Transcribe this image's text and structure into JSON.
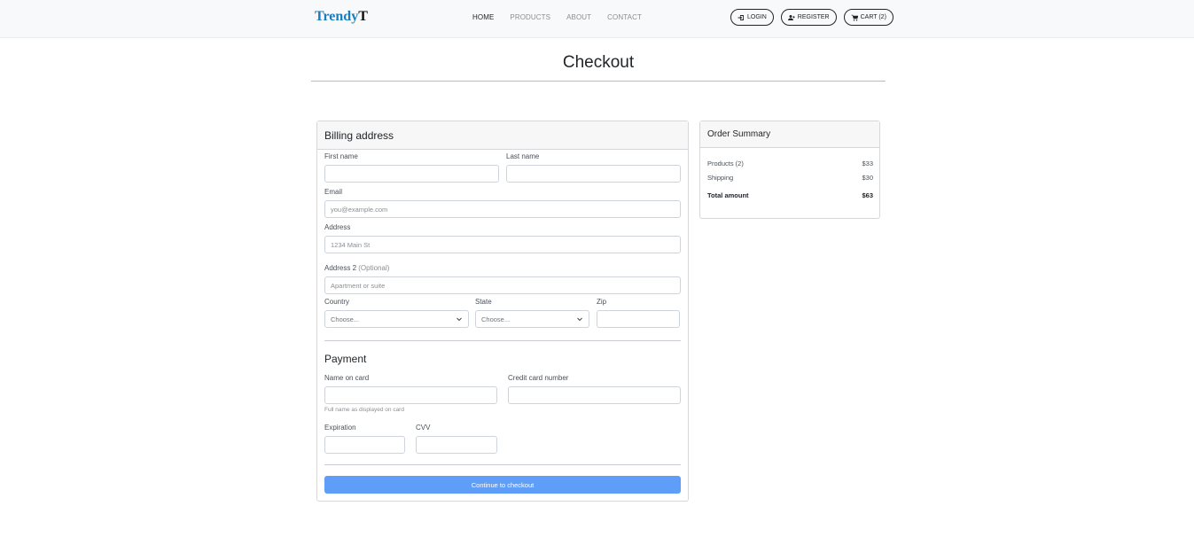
{
  "brand": {
    "part1": "Trendy",
    "part2": "T"
  },
  "nav": {
    "links": [
      {
        "label": "HOME"
      },
      {
        "label": "PRODUCTS"
      },
      {
        "label": "ABOUT"
      },
      {
        "label": "CONTACT"
      }
    ],
    "login_label": "LOGIN",
    "register_label": "REGISTER",
    "cart_label": "CART (2)"
  },
  "page": {
    "title": "Checkout"
  },
  "billing": {
    "header": "Billing address",
    "first_name_label": "First name",
    "last_name_label": "Last name",
    "email_label": "Email",
    "email_placeholder": "you@example.com",
    "address_label": "Address",
    "address_placeholder": "1234 Main St",
    "address2_label": "Address 2",
    "address2_optional": "(Optional)",
    "address2_placeholder": "Apartment or suite",
    "country_label": "Country",
    "country_value": "Choose...",
    "state_label": "State",
    "state_value": "Choose...",
    "zip_label": "Zip"
  },
  "payment": {
    "title": "Payment",
    "name_on_card_label": "Name on card",
    "name_on_card_help": "Full name as displayed on card",
    "card_number_label": "Credit card number",
    "expiration_label": "Expiration",
    "cvv_label": "CVV",
    "submit_label": "Continue to checkout"
  },
  "summary": {
    "header": "Order Summary",
    "products_label": "Products (2)",
    "products_value": "$33",
    "shipping_label": "Shipping",
    "shipping_value": "$30",
    "total_label": "Total amount",
    "total_value": "$63"
  },
  "colors": {
    "brand_blue": "#1b7dbf",
    "button_primary": "#5f9ef8",
    "navbar_bg": "#f8f9fa"
  },
  "icons": {
    "login": "sign-in-icon",
    "register": "user-plus-icon",
    "cart": "cart-icon",
    "select": "chevron-down-icon"
  }
}
